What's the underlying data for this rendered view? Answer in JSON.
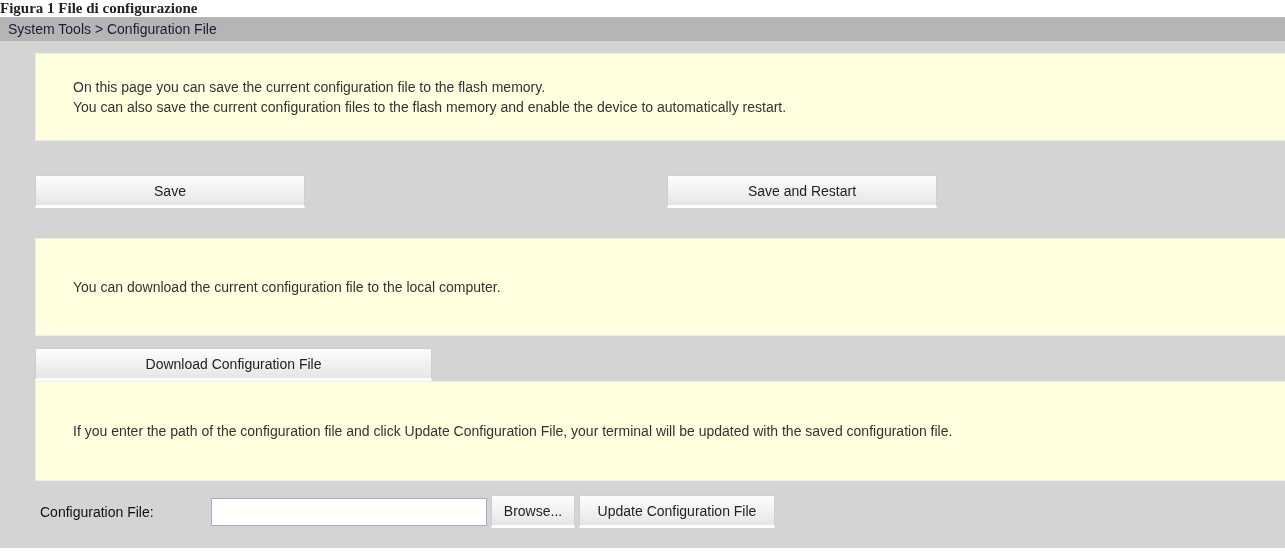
{
  "caption": "Figura 1 File di configurazione",
  "breadcrumb": "System Tools > Configuration File",
  "save_section": {
    "notes": [
      "On this page you can save the current configuration file to the flash memory.",
      "You can also save the current configuration files to the flash memory and enable the device to automatically restart."
    ],
    "buttons": [
      "Save",
      "Save and Restart"
    ]
  },
  "download_section": {
    "note": "You can download the current configuration file to the local computer.",
    "button": "Download Configuration File"
  },
  "update_section": {
    "note": "If you enter the path of the configuration file and click Update Configuration File, your terminal will be updated with the saved configuration file.",
    "field_label": "Configuration File:",
    "browse_button": "Browse...",
    "update_button": "Update Configuration File"
  }
}
